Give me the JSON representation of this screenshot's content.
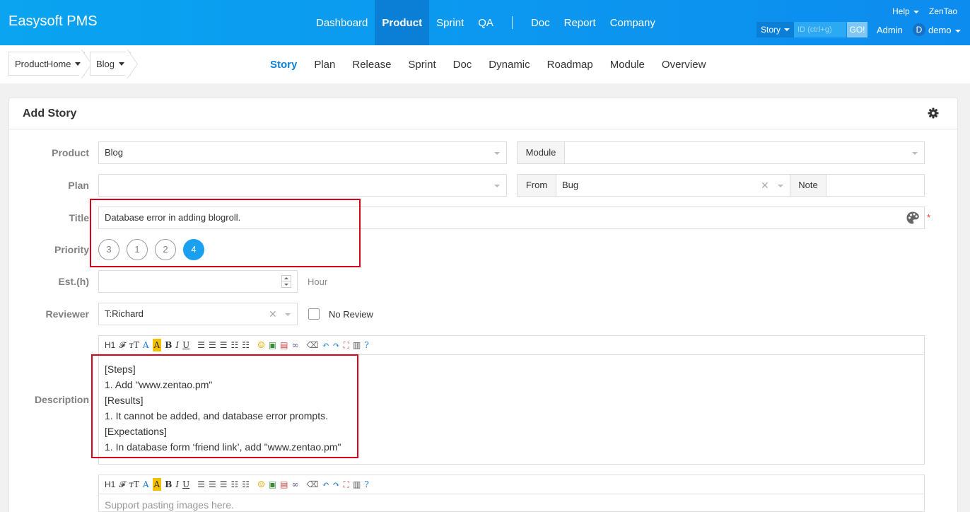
{
  "app": {
    "title": "Easysoft PMS"
  },
  "topnav": {
    "items": [
      "Dashboard",
      "Product",
      "Sprint",
      "QA"
    ],
    "items2": [
      "Doc",
      "Report",
      "Company"
    ],
    "active": "Product",
    "help": "Help",
    "zentao": "ZenTao",
    "search_type": "Story",
    "search_placeholder": "ID (ctrl+g)",
    "go": "GO!",
    "admin": "Admin",
    "avatar_letter": "D",
    "user": "demo"
  },
  "breadcrumb": {
    "product_home": "ProductHome",
    "product": "Blog"
  },
  "subnav": {
    "items": [
      "Story",
      "Plan",
      "Release",
      "Sprint",
      "Doc",
      "Dynamic",
      "Roadmap",
      "Module",
      "Overview"
    ],
    "active": "Story"
  },
  "form": {
    "title": "Add Story",
    "product_label": "Product",
    "product_value": "Blog",
    "module_label": "Module",
    "module_value": "",
    "plan_label": "Plan",
    "plan_value": "",
    "from_label": "From",
    "from_value": "Bug",
    "note_label": "Note",
    "note_value": "",
    "title_label": "Title",
    "title_value": "Database error in adding blogroll.",
    "required_mark": "*",
    "priority_label": "Priority",
    "priorities": [
      "3",
      "1",
      "2",
      "4"
    ],
    "priority_selected": "4",
    "est_label": "Est.(h)",
    "est_value": "",
    "est_unit": "Hour",
    "reviewer_label": "Reviewer",
    "reviewer_value": "T:Richard",
    "no_review_label": "No Review",
    "description_label": "Description",
    "description_lines": [
      "[Steps]",
      "1. Add \"www.zentao.pm\"",
      "[Results]",
      "1. It cannot be added, and database error prompts.",
      "[Expectations]",
      "1. In database form ‘friend link’, add \"www.zentao.pm\""
    ],
    "verify_placeholder": "Support pasting images here."
  },
  "toolbar_glyphs": {
    "heading": "H1",
    "font": "𝓕",
    "size": "тT",
    "color": "A",
    "highlight": "A",
    "bold": "B",
    "italic": "I",
    "underline": "U"
  },
  "colors": {
    "nav_start": "#0aa4f0",
    "nav_end": "#0d8cef",
    "accent": "#1ba0f0",
    "highlight_box": "#d9001b"
  }
}
